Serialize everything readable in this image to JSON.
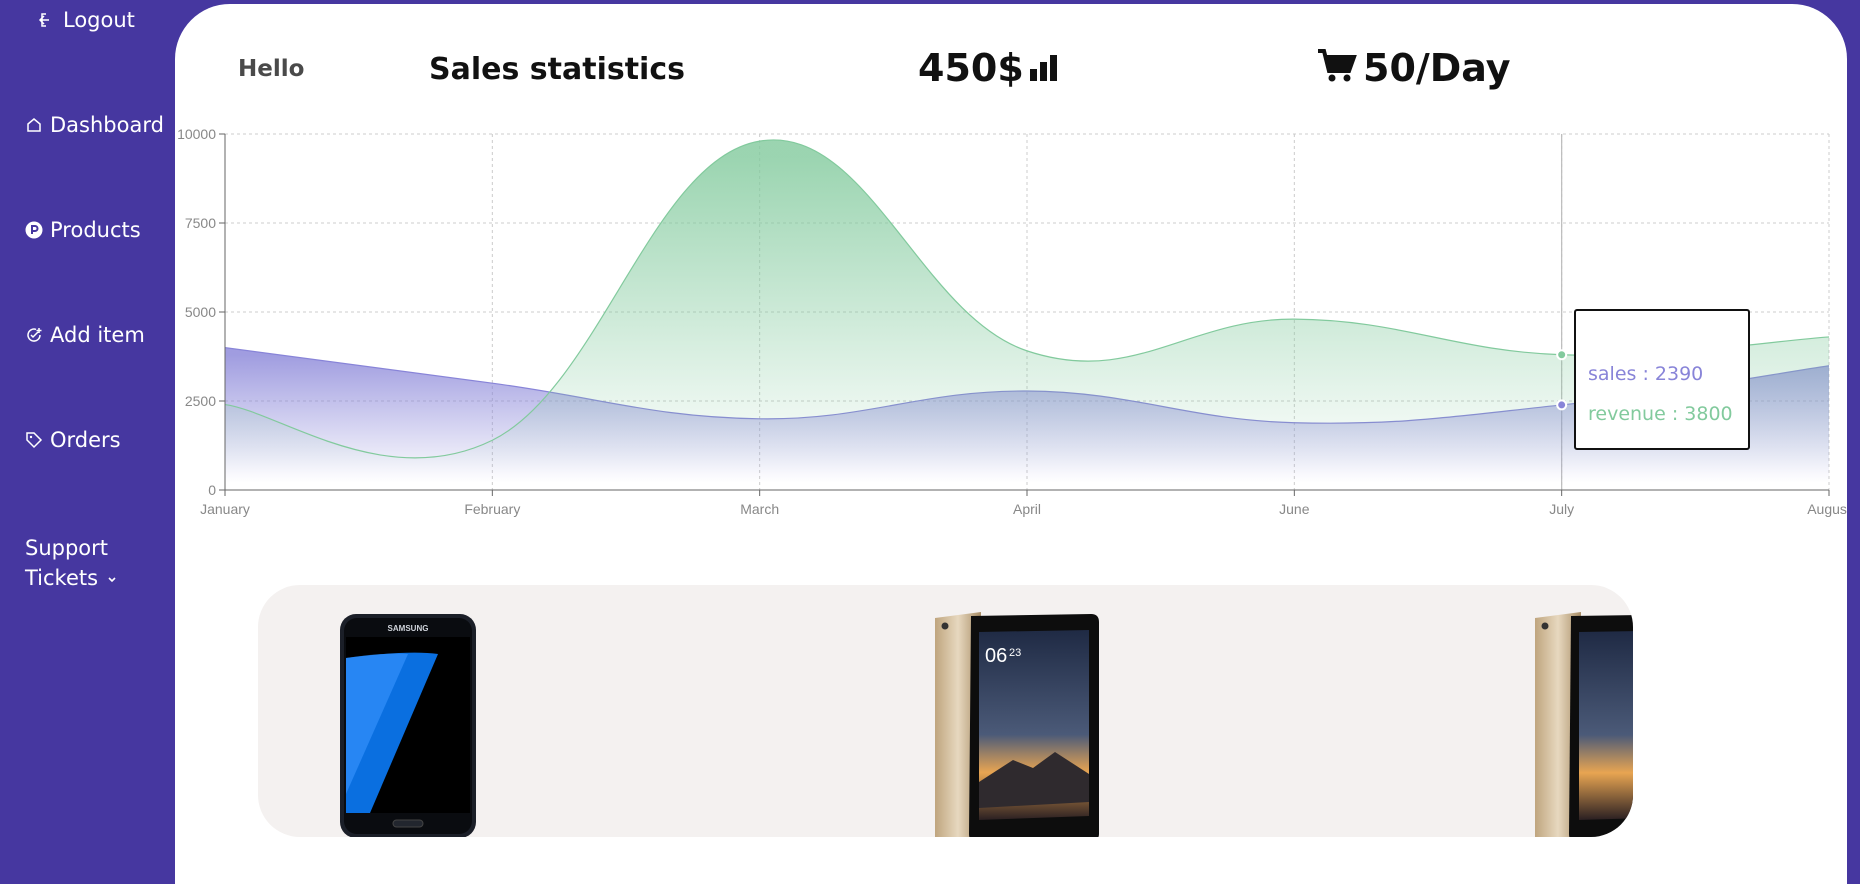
{
  "sidebar": {
    "logout": "Logout",
    "items": [
      {
        "label": "Dashboard",
        "icon": "home-icon"
      },
      {
        "label": "Products",
        "icon": "p-circle-icon"
      },
      {
        "label": "Add item",
        "icon": "add-check-icon"
      },
      {
        "label": "Orders",
        "icon": "tag-icon"
      }
    ],
    "support_line1": "Support",
    "support_line2": "Tickets"
  },
  "header": {
    "greeting": "Hello",
    "title": "Sales statistics",
    "price": "450$",
    "per_day": "50/Day"
  },
  "tooltip": {
    "sales": "sales : 2390",
    "revenue": "revenue : 3800"
  },
  "colors": {
    "sidebar_bg": "#4637a0",
    "sales": "#8884d8",
    "revenue": "#82ca9d"
  },
  "chart_data": {
    "type": "area",
    "categories": [
      "January",
      "February",
      "March",
      "April",
      "June",
      "July",
      "August"
    ],
    "series": [
      {
        "name": "sales",
        "values": [
          4000,
          3000,
          2000,
          2780,
          1890,
          2390,
          3490
        ]
      },
      {
        "name": "revenue",
        "values": [
          2400,
          1398,
          9800,
          3908,
          4800,
          3800,
          4300
        ]
      }
    ],
    "yticks": [
      0,
      2500,
      5000,
      7500,
      10000
    ],
    "ylim": [
      0,
      10000
    ],
    "grid": true,
    "active_category": "July"
  },
  "products": [
    {
      "name": "samsung-phone"
    },
    {
      "name": "tablet"
    },
    {
      "name": "tablet-partial"
    }
  ]
}
